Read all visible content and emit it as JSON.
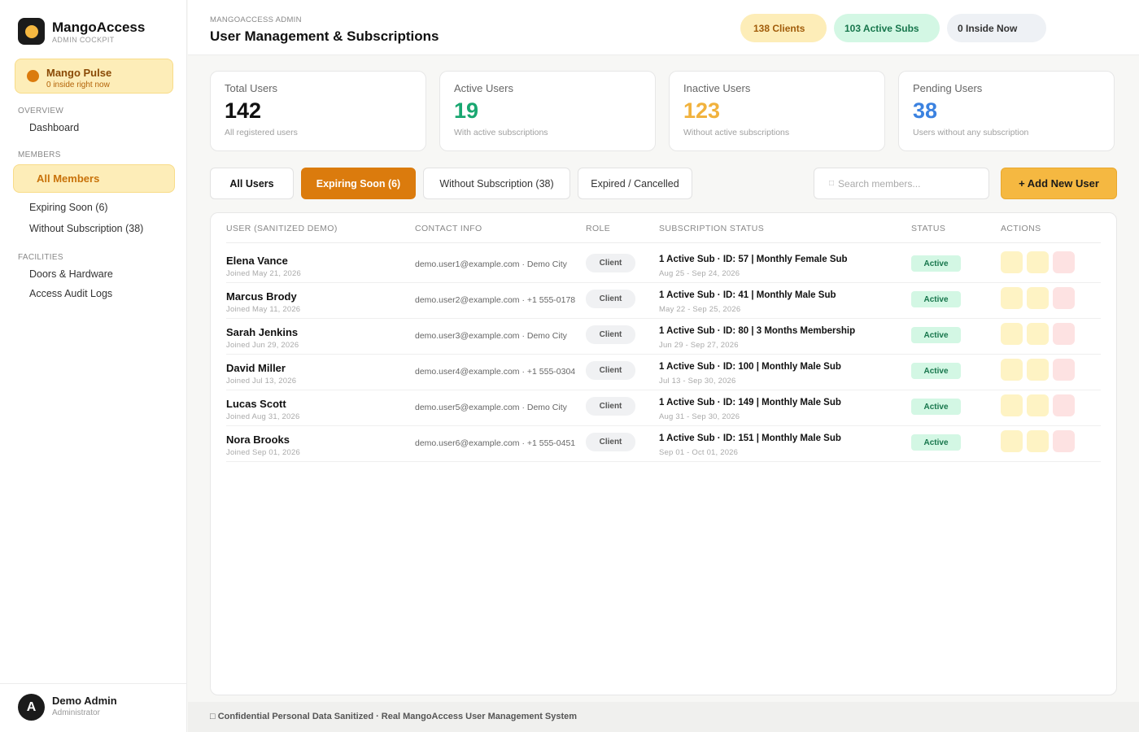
{
  "brand": {
    "name": "MangoAccess",
    "subtitle": "ADMIN COCKPIT"
  },
  "pulse": {
    "title": "Mango Pulse",
    "subtitle": "0 inside right now"
  },
  "sidebar": {
    "overview_label": "OVERVIEW",
    "dashboard": "Dashboard",
    "members_label": "MEMBERS",
    "all_members": "All Members",
    "expiring_soon": "Expiring Soon (6)",
    "without_subscription": "Without Subscription (38)",
    "facilities_label": "FACILITIES",
    "doors_hardware": "Doors & Hardware",
    "access_audit_logs": "Access Audit Logs"
  },
  "user": {
    "initial": "A",
    "name": "Demo Admin",
    "role": "Administrator"
  },
  "header": {
    "breadcrumb": "MANGOACCESS ADMIN",
    "title": "User Management & Subscriptions",
    "pills": {
      "clients": "138 Clients",
      "active_subs": "103 Active Subs",
      "inside_now": "0 Inside Now"
    }
  },
  "stats": [
    {
      "label": "Total Users",
      "value": "142",
      "sub": "All registered users",
      "color": "#111111"
    },
    {
      "label": "Active Users",
      "value": "19",
      "sub": "With active subscriptions",
      "color": "#1aa771"
    },
    {
      "label": "Inactive Users",
      "value": "123",
      "sub": "Without active subscriptions",
      "color": "#f1b23d"
    },
    {
      "label": "Pending Users",
      "value": "38",
      "sub": "Users without any subscription",
      "color": "#3b82e0"
    }
  ],
  "filters": {
    "all_users": "All Users",
    "expiring_soon": "Expiring Soon (6)",
    "without_subscription": "Without Subscription (38)",
    "expired_cancelled": "Expired / Cancelled"
  },
  "search": {
    "placeholder": "Search members...",
    "icon": "search-icon"
  },
  "add_button": "+ Add New User",
  "table": {
    "columns": [
      "USER (SANITIZED DEMO)",
      "CONTACT INFO",
      "ROLE",
      "SUBSCRIPTION STATUS",
      "STATUS",
      "ACTIONS"
    ],
    "rows": [
      {
        "name": "Elena Vance",
        "joined": "Joined May 21, 2026",
        "contact": "demo.user1@example.com · Demo City",
        "role": "Client",
        "subscription": "1 Active Sub · ID: 57 | Monthly Female Sub",
        "dates": "Aug 25 - Sep 24, 2026",
        "status": "Active"
      },
      {
        "name": "Marcus Brody",
        "joined": "Joined May 11, 2026",
        "contact": "demo.user2@example.com · +1 555-0178",
        "role": "Client",
        "subscription": "1 Active Sub · ID: 41 | Monthly Male Sub",
        "dates": "May 22 - Sep 25, 2026",
        "status": "Active"
      },
      {
        "name": "Sarah Jenkins",
        "joined": "Joined Jun 29, 2026",
        "contact": "demo.user3@example.com · Demo City",
        "role": "Client",
        "subscription": "1 Active Sub · ID: 80 | 3 Months Membership",
        "dates": "Jun 29 - Sep 27, 2026",
        "status": "Active"
      },
      {
        "name": "David Miller",
        "joined": "Joined Jul 13, 2026",
        "contact": "demo.user4@example.com · +1 555-0304",
        "role": "Client",
        "subscription": "1 Active Sub · ID: 100 | Monthly Male Sub",
        "dates": "Jul 13 - Sep 30, 2026",
        "status": "Active"
      },
      {
        "name": "Lucas Scott",
        "joined": "Joined Aug 31, 2026",
        "contact": "demo.user5@example.com · Demo City",
        "role": "Client",
        "subscription": "1 Active Sub · ID: 149 | Monthly Male Sub",
        "dates": "Aug 31 - Sep 30, 2026",
        "status": "Active"
      },
      {
        "name": "Nora Brooks",
        "joined": "Joined Sep 01, 2026",
        "contact": "demo.user6@example.com · +1 555-0451",
        "role": "Client",
        "subscription": "1 Active Sub · ID: 151 | Monthly Male Sub",
        "dates": "Sep 01 - Oct 01, 2026",
        "status": "Active"
      }
    ]
  },
  "footer": "Confidential Personal Data Sanitized · Real MangoAccess User Management System"
}
